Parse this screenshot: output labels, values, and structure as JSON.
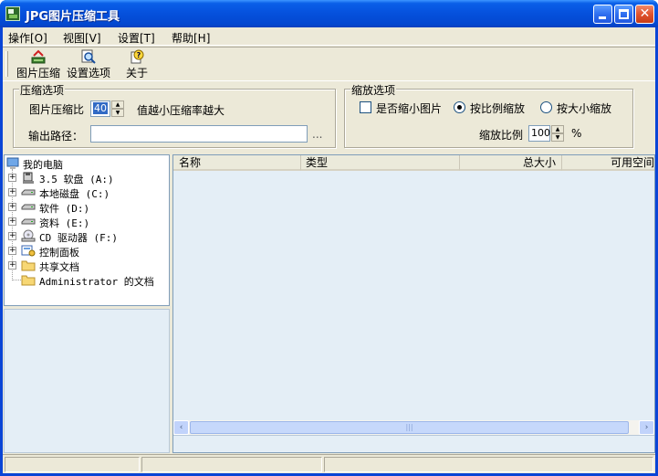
{
  "window": {
    "title": "JPG图片压缩工具",
    "controls": {
      "minimize": "",
      "maximize": "",
      "close": "✕"
    }
  },
  "menu": [
    {
      "label": "操作[O]"
    },
    {
      "label": "视图[V]"
    },
    {
      "label": "设置[T]"
    },
    {
      "label": "帮助[H]"
    }
  ],
  "toolbar": [
    {
      "label": "图片压缩",
      "icon": "compress-icon"
    },
    {
      "label": "设置选项",
      "icon": "magnifier-settings-icon"
    },
    {
      "label": "关于",
      "icon": "help-about-icon"
    }
  ],
  "compress_group": {
    "title": "压缩选项",
    "ratio_label": "图片压缩比",
    "ratio_value": "40",
    "ratio_hint": "值越小压缩率越大",
    "output_label": "输出路径：",
    "output_value": "",
    "browse_label": "..."
  },
  "scale_group": {
    "title": "缩放选项",
    "shrink_label": "是否缩小图片",
    "shrink_checked": false,
    "by_ratio_label": "按比例缩放",
    "by_ratio_selected": true,
    "by_size_label": "按大小缩放",
    "scale_ratio_label": "缩放比例",
    "scale_ratio_value": "100",
    "percent": "%"
  },
  "tree": [
    {
      "label": "我的电脑",
      "icon": "computer-icon",
      "level": 0,
      "expander": ""
    },
    {
      "label": "3.5 软盘 (A:)",
      "icon": "floppy-icon",
      "level": 1,
      "expander": "+"
    },
    {
      "label": "本地磁盘 (C:)",
      "icon": "drive-icon",
      "level": 1,
      "expander": "+"
    },
    {
      "label": "软件 (D:)",
      "icon": "drive-icon",
      "level": 1,
      "expander": "+"
    },
    {
      "label": "资料 (E:)",
      "icon": "drive-icon",
      "level": 1,
      "expander": "+"
    },
    {
      "label": "CD 驱动器 (F:)",
      "icon": "cd-drive-icon",
      "level": 1,
      "expander": "+"
    },
    {
      "label": "控制面板",
      "icon": "control-panel-icon",
      "level": 1,
      "expander": "+"
    },
    {
      "label": "共享文档",
      "icon": "folder-icon",
      "level": 1,
      "expander": "+"
    },
    {
      "label": "Administrator 的文档",
      "icon": "folder-icon",
      "level": 1,
      "expander": ""
    }
  ],
  "list": {
    "columns": [
      "名称",
      "类型",
      "总大小",
      "可用空间"
    ],
    "rows": []
  },
  "scrollbar": {
    "left": "‹",
    "right": "›",
    "grip": "|||"
  },
  "colors": {
    "title_bar": "#0550dc",
    "selection": "#316ac5",
    "list_background": "#e4eef6"
  }
}
